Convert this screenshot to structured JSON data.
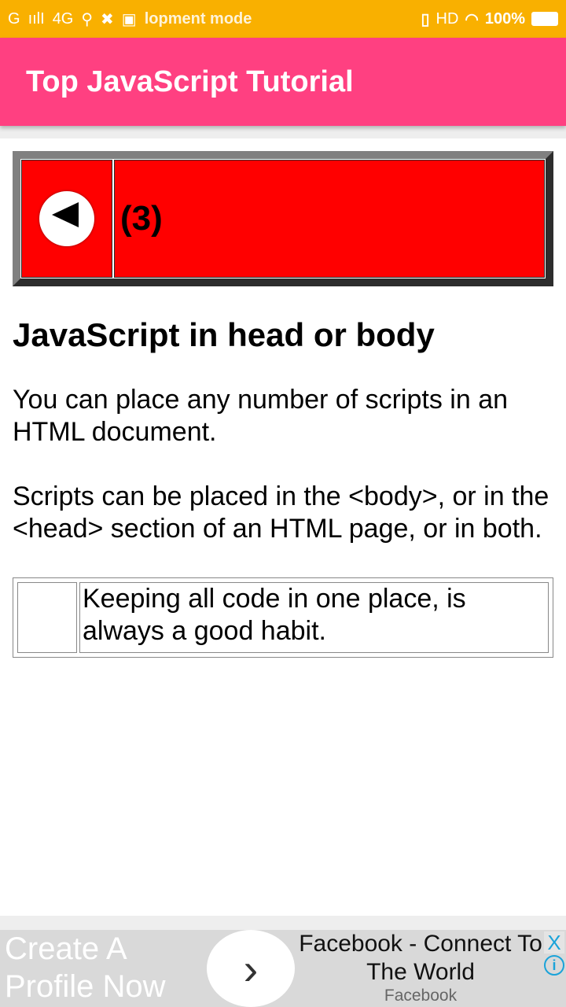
{
  "status": {
    "carrier1": "G",
    "carrier2": "4G",
    "dev": "lopment mode",
    "hd": "HD",
    "battery": "100%"
  },
  "appbar": {
    "title": "Top JavaScript Tutorial"
  },
  "nav": {
    "page": "(3)"
  },
  "article": {
    "heading": "JavaScript in head or body",
    "paragraphs": [
      "You can place any number of scripts in an HTML document.",
      "Scripts can be placed in the <body>, or in the <head> section of an HTML page, or in both."
    ],
    "note": "Keeping all code in one place, is always a good habit."
  },
  "ad": {
    "left": "Create A Profile Now",
    "title": "Facebook - Connect To The World",
    "advertiser": "Facebook",
    "close": "X",
    "info": "i"
  }
}
